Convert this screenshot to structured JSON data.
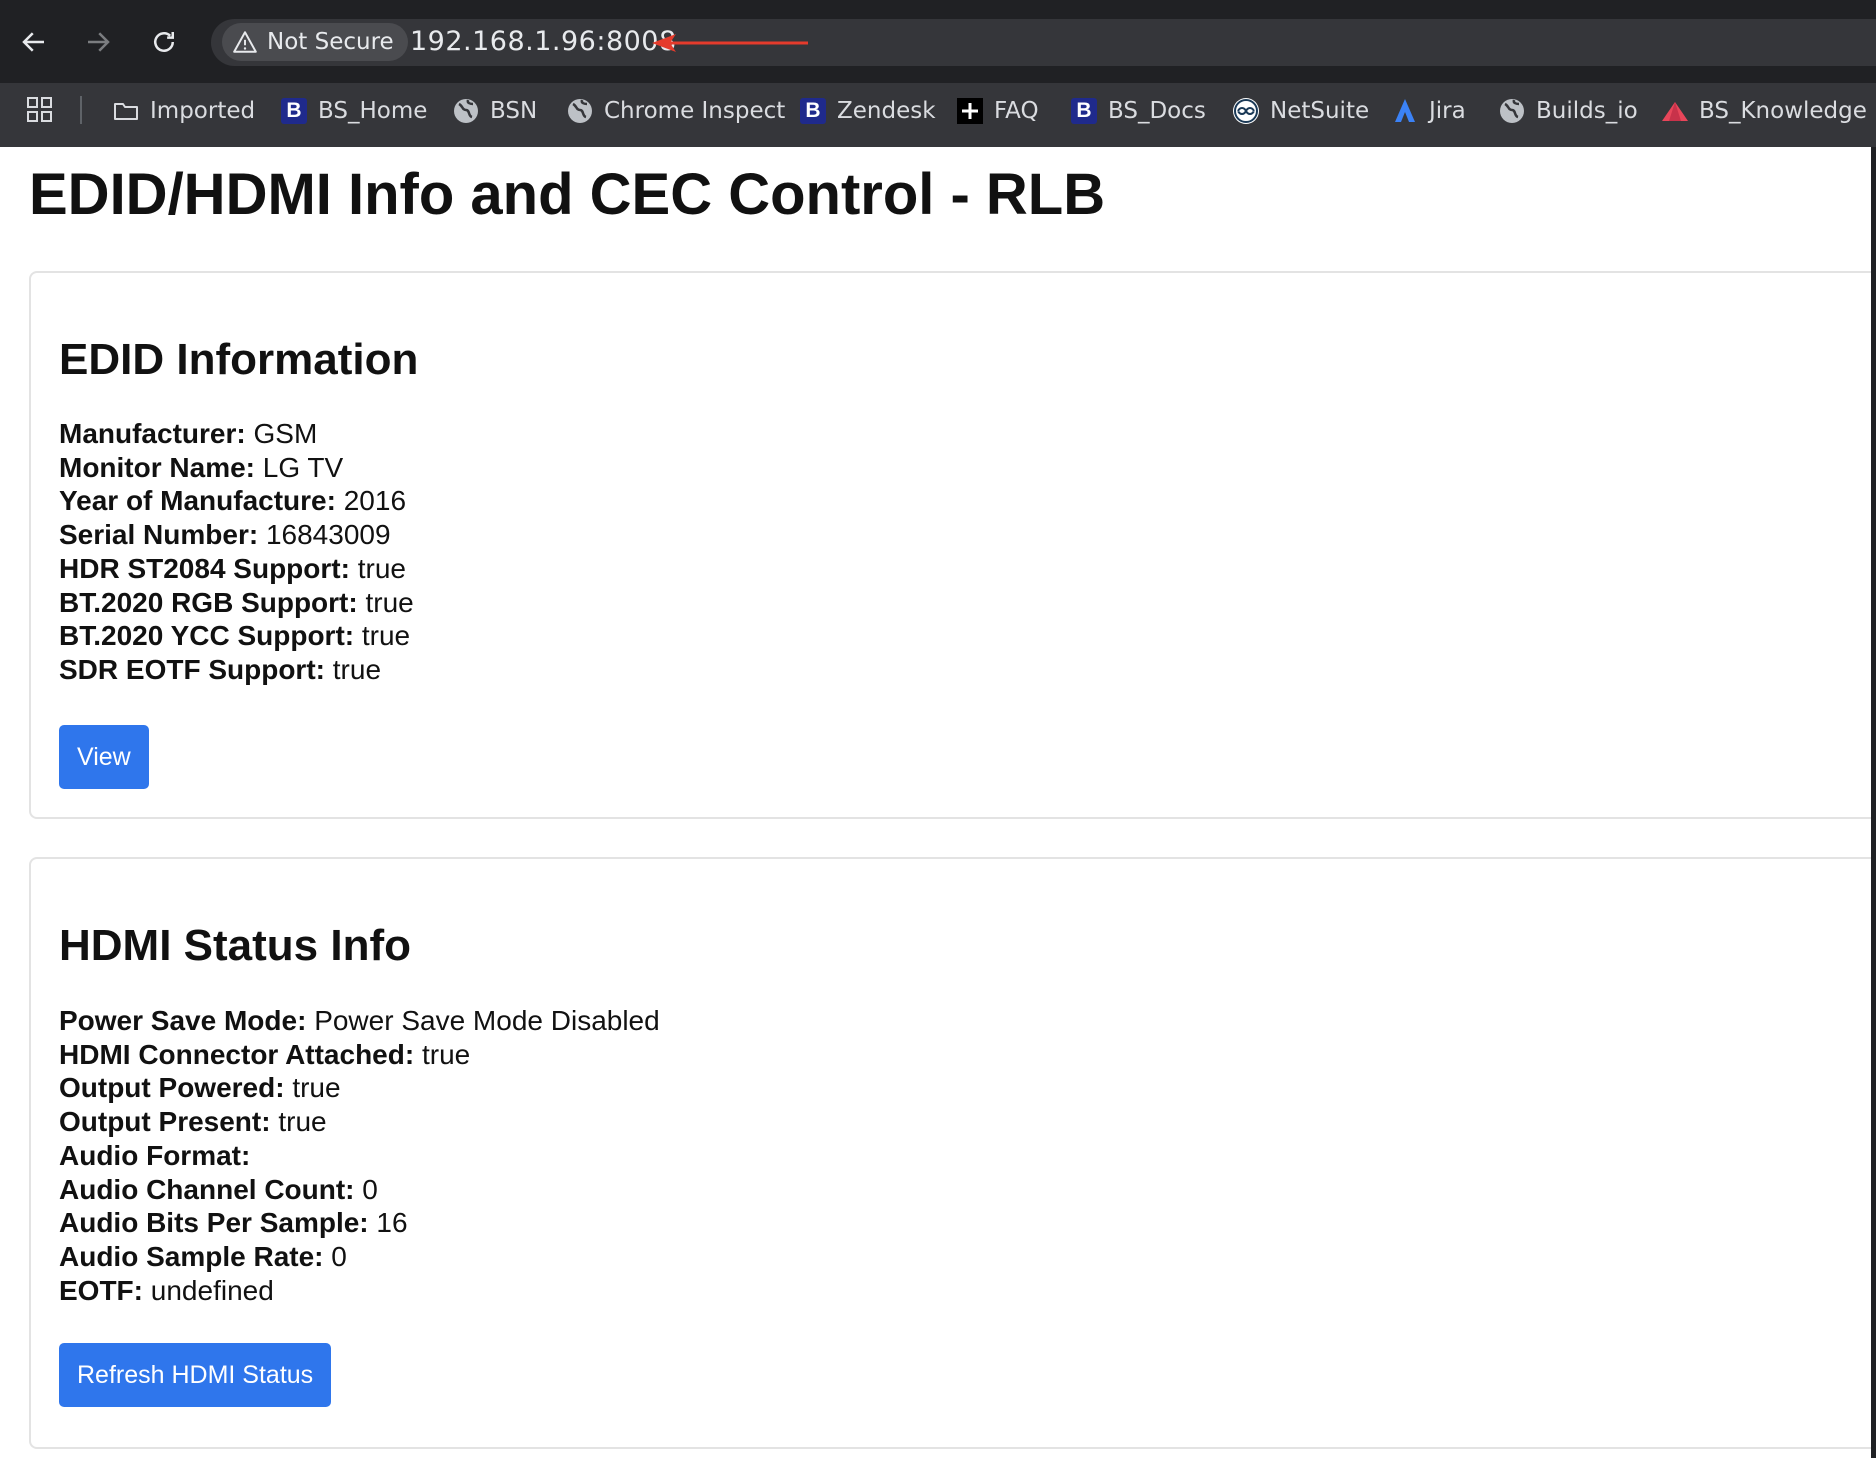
{
  "browser": {
    "security_label": "Not Secure",
    "url": "192.168.1.96:8008",
    "bookmarks": [
      {
        "label": "Imported",
        "icon": "folder-icon"
      },
      {
        "label": "BS_Home",
        "icon": "b-logo-icon"
      },
      {
        "label": "BSN",
        "icon": "globe-icon"
      },
      {
        "label": "Chrome Inspect",
        "icon": "globe-icon"
      },
      {
        "label": "Zendesk",
        "icon": "b-logo-icon"
      },
      {
        "label": "FAQ",
        "icon": "plus-icon"
      },
      {
        "label": "BS_Docs",
        "icon": "b-logo-icon"
      },
      {
        "label": "NetSuite",
        "icon": "netsuite-icon"
      },
      {
        "label": "Jira",
        "icon": "jira-icon"
      },
      {
        "label": "Builds_io",
        "icon": "globe-icon"
      },
      {
        "label": "BS_Knowledge",
        "icon": "triangle-logo-icon"
      }
    ]
  },
  "page": {
    "title": "EDID/HDMI Info and CEC Control - RLB"
  },
  "edid": {
    "heading": "EDID Information",
    "fields": [
      {
        "label": "Manufacturer:",
        "value": "GSM"
      },
      {
        "label": "Monitor Name:",
        "value": "LG TV"
      },
      {
        "label": "Year of Manufacture:",
        "value": "2016"
      },
      {
        "label": "Serial Number:",
        "value": "16843009"
      },
      {
        "label": "HDR ST2084 Support:",
        "value": "true"
      },
      {
        "label": "BT.2020 RGB Support:",
        "value": "true"
      },
      {
        "label": "BT.2020 YCC Support:",
        "value": "true"
      },
      {
        "label": "SDR EOTF Support:",
        "value": "true"
      }
    ],
    "button_label": "View"
  },
  "hdmi": {
    "heading": "HDMI Status Info",
    "fields": [
      {
        "label": "Power Save Mode:",
        "value": "Power Save Mode Disabled"
      },
      {
        "label": "HDMI Connector Attached:",
        "value": "true"
      },
      {
        "label": "Output Powered:",
        "value": "true"
      },
      {
        "label": "Output Present:",
        "value": "true"
      },
      {
        "label": "Audio Format:",
        "value": ""
      },
      {
        "label": "Audio Channel Count:",
        "value": "0"
      },
      {
        "label": "Audio Bits Per Sample:",
        "value": "16"
      },
      {
        "label": "Audio Sample Rate:",
        "value": "0"
      },
      {
        "label": "EOTF:",
        "value": "undefined"
      }
    ],
    "button_label": "Refresh HDMI Status"
  },
  "colors": {
    "accent": "#2f76ec",
    "annotation": "#e53b2c",
    "chrome_dark": "#202124",
    "chrome_toolbar": "#35363a"
  }
}
